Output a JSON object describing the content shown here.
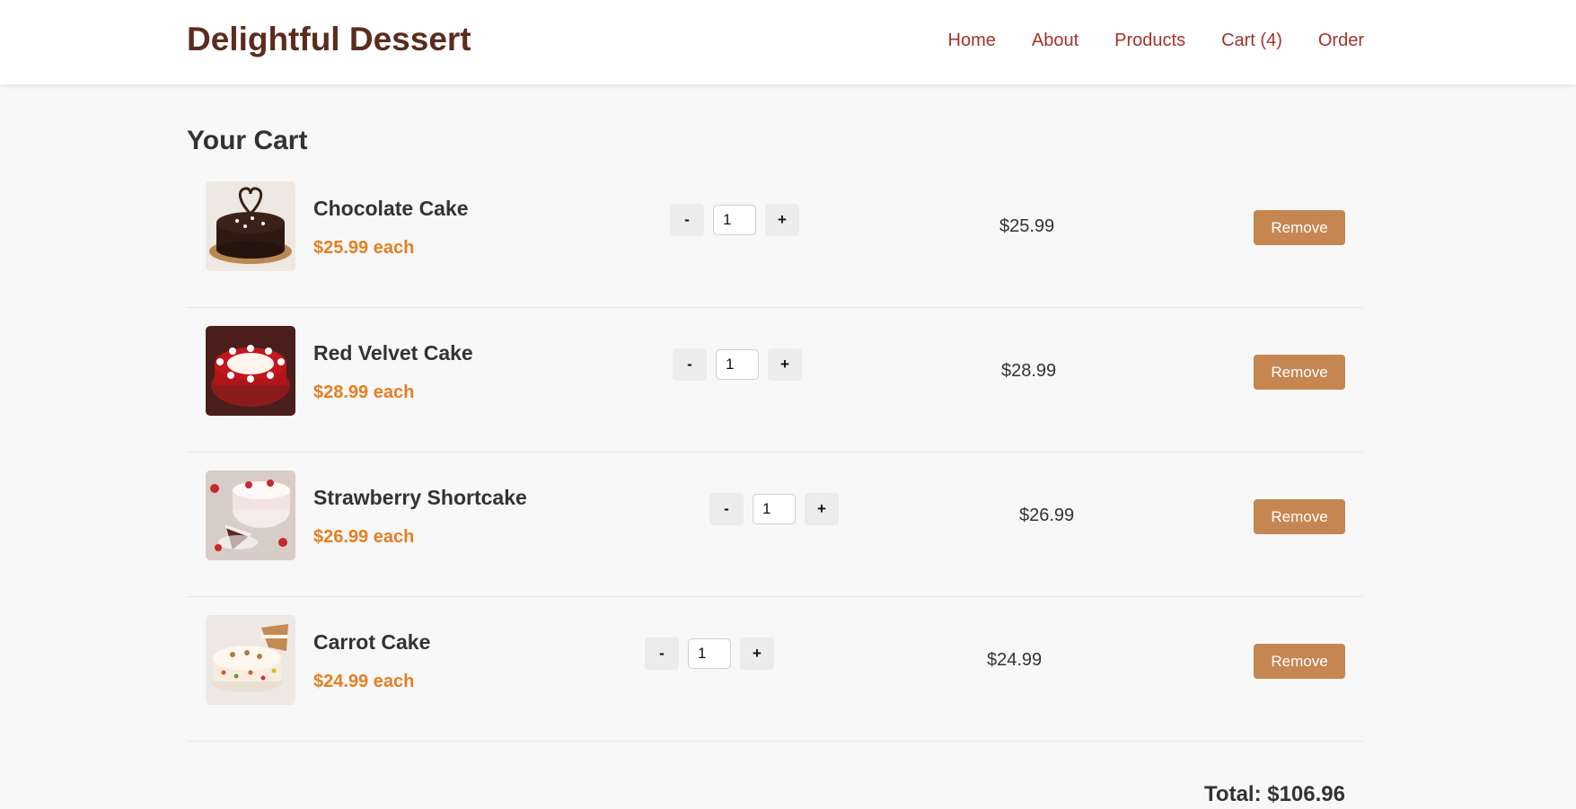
{
  "header": {
    "brand": "Delightful Dessert",
    "nav": [
      "Home",
      "About",
      "Products",
      "Cart (4)",
      "Order"
    ]
  },
  "cart": {
    "title": "Your Cart",
    "remove_label": "Remove",
    "minus_label": "-",
    "plus_label": "+",
    "items": [
      {
        "name": "Chocolate Cake",
        "unit_price": "$25.99 each",
        "quantity": "1",
        "line_total": "$25.99",
        "image_icon": "chocolate-cake-photo"
      },
      {
        "name": "Red Velvet Cake",
        "unit_price": "$28.99 each",
        "quantity": "1",
        "line_total": "$28.99",
        "image_icon": "red-velvet-cake-photo"
      },
      {
        "name": "Strawberry Shortcake",
        "unit_price": "$26.99 each",
        "quantity": "1",
        "line_total": "$26.99",
        "image_icon": "strawberry-shortcake-photo"
      },
      {
        "name": "Carrot Cake",
        "unit_price": "$24.99 each",
        "quantity": "1",
        "line_total": "$24.99",
        "image_icon": "carrot-cake-photo"
      }
    ],
    "total": "Total: $106.96"
  },
  "colors": {
    "brand": "#5b2c1e",
    "nav_link": "#a5312a",
    "unit_price": "#e67e22",
    "remove_button": "#c68651",
    "background": "#f8f8f8"
  }
}
